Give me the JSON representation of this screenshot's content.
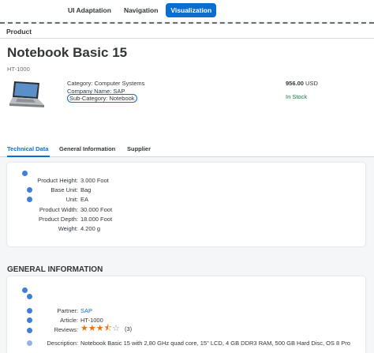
{
  "top_tabs": [
    "UI Adaptation",
    "Navigation",
    "Visualization"
  ],
  "subheader": "Product",
  "title": "Notebook Basic 15",
  "product_id": "HT-1000",
  "attributes": {
    "category": "Category: Computer Systems",
    "company": "Company Name: SAP",
    "subcategory": "Sub-Category: Notebook"
  },
  "price": {
    "amount": "956.00",
    "currency": "USD"
  },
  "stock": "In Stock",
  "section_tabs": [
    "Technical Data",
    "General Information",
    "Supplier"
  ],
  "technical_data": [
    {
      "label": "Product Height:",
      "value": "3.000 Foot"
    },
    {
      "label": "Base Unit:",
      "value": "Bag"
    },
    {
      "label": "Unit:",
      "value": "EA"
    },
    {
      "label": "Product Width:",
      "value": "30.000 Foot"
    },
    {
      "label": "Product Depth:",
      "value": "18.000 Foot"
    },
    {
      "label": "Weight:",
      "value": "4.200 g"
    }
  ],
  "general_information": {
    "heading": "GENERAL INFORMATION",
    "partner_label": "Partner:",
    "partner_value": "SAP",
    "article_label": "Article:",
    "article_value": "HT-1000",
    "reviews_label": "Reviews:",
    "reviews_rating": 3.5,
    "reviews_count": "(3)",
    "description_label": "Description:",
    "description_value": "Notebook Basic 15 with 2,80 GHz quad core, 15\" LCD, 4 GB DDR3 RAM, 500 GB Hard Disc, OS 8 Pro"
  },
  "colors": {
    "accent": "#0a6ed1",
    "success": "#107e3e",
    "star": "#e9730c"
  }
}
